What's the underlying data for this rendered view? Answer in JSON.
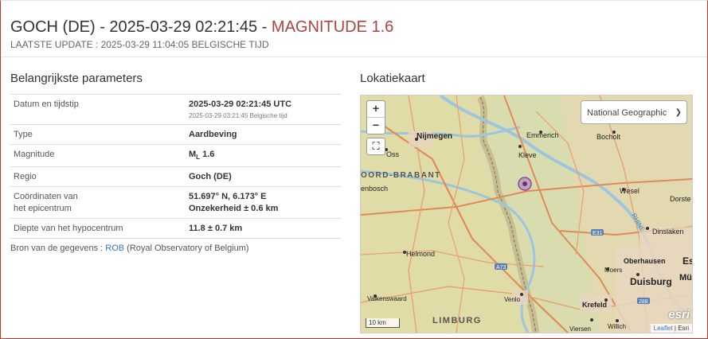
{
  "header": {
    "title_main": "GOCH (DE) - 2025-03-29 02:21:45 - ",
    "title_mag": "MAGNITUDE 1.6",
    "last_update": "LAATSTE UPDATE : 2025-03-29 11:04:05 BELGISCHE TIJD"
  },
  "params": {
    "heading": "Belangrijkste parameters",
    "datetime_label": "Datum en tijdstip",
    "datetime_utc": "2025-03-29 02:21:45 UTC",
    "datetime_local": "2025-03-29 03:21:45 Belgische tijd",
    "type_label": "Type",
    "type_value": "Aardbeving",
    "magnitude_label": "Magnitude",
    "magnitude_prefix": "M",
    "magnitude_sub": "L",
    "magnitude_value": "1.6",
    "region_label": "Regio",
    "region_value": "Goch (DE)",
    "coords_label_1": "Coördinaten van",
    "coords_label_2": "het epicentrum",
    "coords_value": "51.697° N, 6.173° E",
    "coords_uncertainty": "Onzekerheid ± 0.6 km",
    "depth_label": "Diepte van het hypocentrum",
    "depth_value": "11.8 ± 0.7 km"
  },
  "source": {
    "prefix": "Bron van de gegevens : ",
    "link": "ROB",
    "suffix": " (Royal Observatory of Belgium)"
  },
  "map": {
    "heading": "Lokatiekaart",
    "zoom_in": "+",
    "zoom_out": "−",
    "fullscreen": "⛶",
    "layer_selected": "National Geographic",
    "scale_label": "10 km",
    "attribution_link": "Leaflet",
    "attribution_rest": " | Esri",
    "esri_logo": "esri",
    "places": {
      "nijmegen": "Nijmegen",
      "emmerich": "Emmerich",
      "bocholt": "Bocholt",
      "kleve": "Kleve",
      "oss": "Oss",
      "noord_brabant": "OORD-BRABANT",
      "denbosch": "enbosch",
      "wesel": "Wesel",
      "dorsten": "Dorste",
      "rhine": "RHINE",
      "dinslaken": "Dinslaken",
      "helmond": "Helmond",
      "oberhausen": "Oberhausen",
      "moers": "Moers",
      "duisburg": "Duisburg",
      "venlo": "Venlo",
      "krefeld": "Krefeld",
      "limburg": "LIMBURG",
      "valkenswaard": "Valkenswaard",
      "viersen": "Viersen",
      "willich": "Willich",
      "essen": "Es",
      "muelheim": "Mü",
      "a73": "A73",
      "e31": "E31",
      "r288": "288"
    }
  },
  "colors": {
    "magnitude": "#a94442",
    "link": "#337ab7",
    "epicenter": "#8e44ad",
    "border": "#c0392b"
  }
}
